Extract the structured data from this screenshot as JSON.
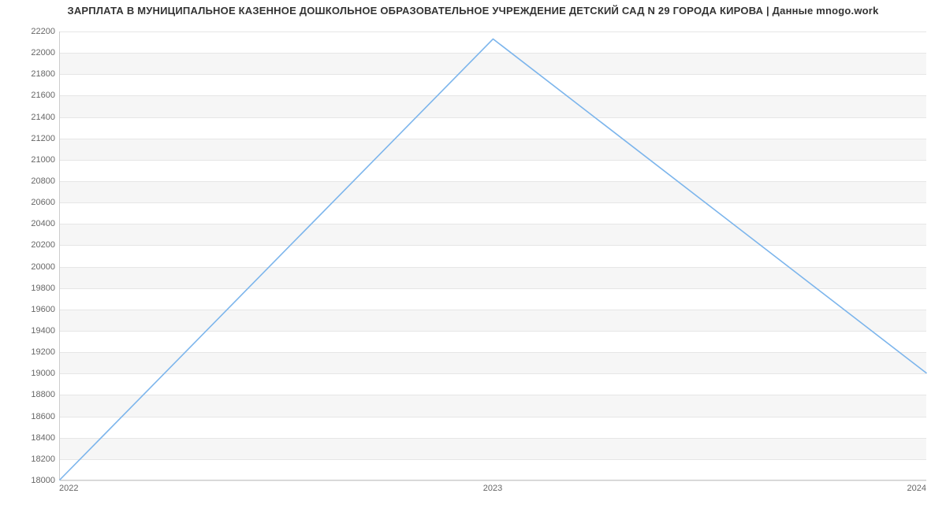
{
  "chart_data": {
    "type": "line",
    "title": "ЗАРПЛАТА В МУНИЦИПАЛЬНОЕ КАЗЕННОЕ ДОШКОЛЬНОЕ ОБРАЗОВАТЕЛЬНОЕ УЧРЕЖДЕНИЕ ДЕТСКИЙ САД N 29 ГОРОДА КИРОВА | Данные mnogo.work",
    "x": [
      "2022",
      "2023",
      "2024"
    ],
    "values": [
      18000,
      22130,
      19000
    ],
    "xlabel": "",
    "ylabel": "",
    "ylim": [
      18000,
      22200
    ],
    "y_ticks": [
      18000,
      18200,
      18400,
      18600,
      18800,
      19000,
      19200,
      19400,
      19600,
      19800,
      20000,
      20200,
      20400,
      20600,
      20800,
      21000,
      21200,
      21400,
      21600,
      21800,
      22000,
      22200
    ],
    "line_color": "#7cb5ec",
    "grid": true
  }
}
